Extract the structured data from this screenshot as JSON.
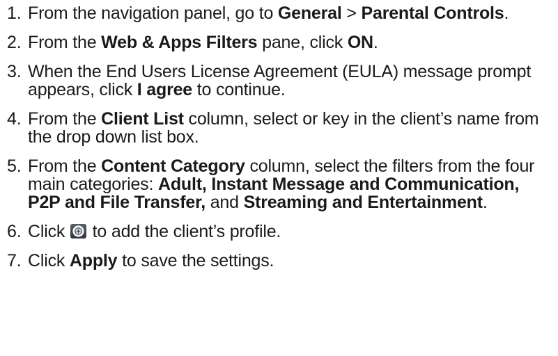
{
  "steps": [
    {
      "num": "1.",
      "parts": [
        "From the navigation panel, go to ",
        "General",
        " > ",
        "Parental Controls",
        "."
      ]
    },
    {
      "num": "2.",
      "parts": [
        "From the ",
        "Web & Apps Filters",
        " pane, click ",
        "ON",
        "."
      ]
    },
    {
      "num": "3.",
      "parts": [
        "When the End Users License Agreement (EULA) message prompt appears, click ",
        "I agree",
        " to continue."
      ]
    },
    {
      "num": "4.",
      "parts": [
        "From the ",
        "Client List",
        " column, select or key in the client’s name from the drop down list box."
      ]
    },
    {
      "num": "5.",
      "parts": [
        "From the ",
        "Content Category",
        " column, select the filters from the four main categories: ",
        "Adult, Instant Message and Communication, P2P and File Transfer,",
        " and ",
        "Streaming and Entertainment",
        "."
      ]
    },
    {
      "num": "6.",
      "parts": [
        "Click ",
        " to add the client’s profile."
      ],
      "icon": "add-circle-icon"
    },
    {
      "num": "7.",
      "parts": [
        "Click ",
        "Apply",
        " to save the settings."
      ]
    }
  ]
}
